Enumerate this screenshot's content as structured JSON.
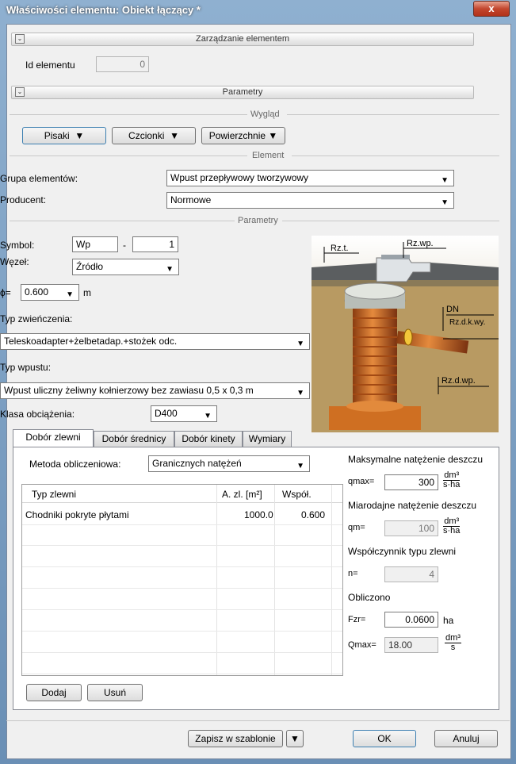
{
  "window": {
    "title": "Właściwości elementu: Obiekt łączący *",
    "close": "x"
  },
  "sections": {
    "management": "Zarządzanie elementem",
    "parameters": "Parametry"
  },
  "id_field": {
    "label": "Id elementu",
    "value": "0"
  },
  "groups": {
    "appearance": "Wygląd",
    "element": "Element",
    "parameters": "Parametry"
  },
  "appearance_buttons": {
    "pens": "Pisaki",
    "fonts": "Czcionki",
    "surfaces": "Powierzchnie"
  },
  "element": {
    "group_label": "Grupa elementów:",
    "group_value": "Wpust przepływowy tworzywowy",
    "producer_label": "Producent:",
    "producer_value": "Normowe"
  },
  "params": {
    "symbol_label": "Symbol:",
    "symbol_value": "Wp",
    "symbol_sep": "-",
    "symbol_number": "1",
    "node_label": "Węzeł:",
    "node_value": "Źródło",
    "phi_label": "ϕ=",
    "phi_value": "0.600",
    "phi_unit": "m",
    "top_type_label": "Typ zwieńczenia:",
    "top_type_value": "Teleskoadapter+żelbetadap.+stożek odc.",
    "inlet_type_label": "Typ wpustu:",
    "inlet_type_value": "Wpust uliczny żeliwny kołnierzowy bez zawiasu 0,5 x 0,3 m",
    "load_class_label": "Klasa obciążenia:",
    "load_class_value": "D400"
  },
  "picture_labels": {
    "rzt": "Rz.t.",
    "rzwp": "Rz.wp.",
    "dn": "DN",
    "rzdkwy": "Rz.d.k.wy.",
    "rzdwp": "Rz.d.wp."
  },
  "tabs": [
    "Dobór zlewni",
    "Dobór średnicy",
    "Dobór kinety",
    "Wymiary"
  ],
  "catchment": {
    "method_label": "Metoda obliczeniowa:",
    "method_value": "Granicznych natężeń",
    "table": {
      "headers": [
        "Typ zlewni",
        "A. zl. [m²]",
        "Współ."
      ],
      "rows": [
        {
          "type": "Chodniki pokryte płytami",
          "area": "1000.0",
          "coef": "0.600"
        }
      ]
    },
    "add_button": "Dodaj",
    "remove_button": "Usuń",
    "max_rain_label": "Maksymalne natężenie deszczu",
    "qmax_label": "qmax=",
    "qmax_value": "300",
    "unit_num": "dm³",
    "unit_den_sha": "s·ha",
    "design_rain_label": "Miarodajne natężenie deszczu",
    "qm_label": "qm=",
    "qm_value": "100",
    "coef_label": "Współczynnik typu zlewni",
    "n_label": "n=",
    "n_value": "4",
    "computed_label": "Obliczono",
    "fzr_label": "Fzr=",
    "fzr_value": "0.0600",
    "fzr_unit": "ha",
    "Qmax_label": "Qmax=",
    "Qmax_value": "18.00",
    "unit_den_s": "s"
  },
  "footer": {
    "save_template": "Zapisz w szablonie",
    "ok": "OK",
    "cancel": "Anuluj"
  },
  "colors": {
    "title_bar": "#7a9cc2",
    "close": "#c3472e",
    "pipe": "#d9782b",
    "soil": "#b08e55"
  }
}
